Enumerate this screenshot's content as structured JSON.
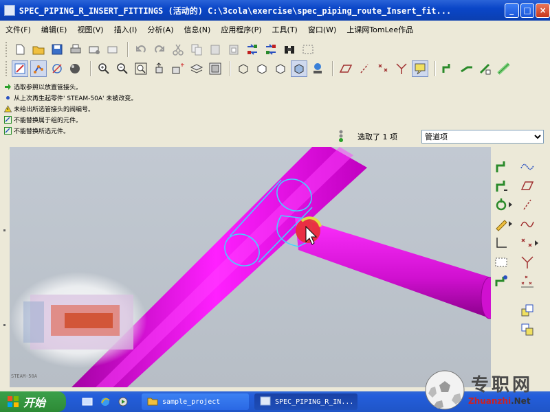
{
  "window": {
    "title": "SPEC_PIPING_R_INSERT_FITTINGS (活动的) C:\\3cola\\exercise\\spec_piping_route_Insert_fit...",
    "minimize": "_",
    "maximize": "□",
    "close": "×"
  },
  "menu": [
    "文件(F)",
    "编辑(E)",
    "视图(V)",
    "插入(I)",
    "分析(A)",
    "信息(N)",
    "应用程序(P)",
    "工具(T)",
    "窗口(W)",
    "上课网TomLee作品"
  ],
  "messages": [
    {
      "icon": "green-arrow-icon",
      "text": "选取参照以放置管接头。"
    },
    {
      "icon": "blue-dot-icon",
      "text": "从上次再生起零件' STEAM-50A' 未被改变。"
    },
    {
      "icon": "warning-icon",
      "text": "未给出所选管接头的阀编号。"
    },
    {
      "icon": "fitting-icon",
      "text": "不能替换属于组的元件。"
    },
    {
      "icon": "fitting-icon",
      "text": "不能替换所选元件。"
    }
  ],
  "selection": {
    "status": "选取了 1 项",
    "filter": "管道项"
  },
  "viewport": {
    "corner_label": "STEAM-50A"
  },
  "taskbar": {
    "start": "开始",
    "tasks": [
      {
        "label": "sample_project",
        "icon": "folder-icon"
      },
      {
        "label": "SPEC_PIPING_R_IN...",
        "icon": "app-window-icon"
      }
    ]
  },
  "watermark": {
    "title": "专职网",
    "sub_red": "Zhuanzhi",
    "sub_dark": ".Net"
  },
  "colors": {
    "pipe": "#e010e0",
    "pipe_dark": "#9a009a",
    "highlight": "#3fd8ff",
    "title_bar": "#0a46c8"
  }
}
